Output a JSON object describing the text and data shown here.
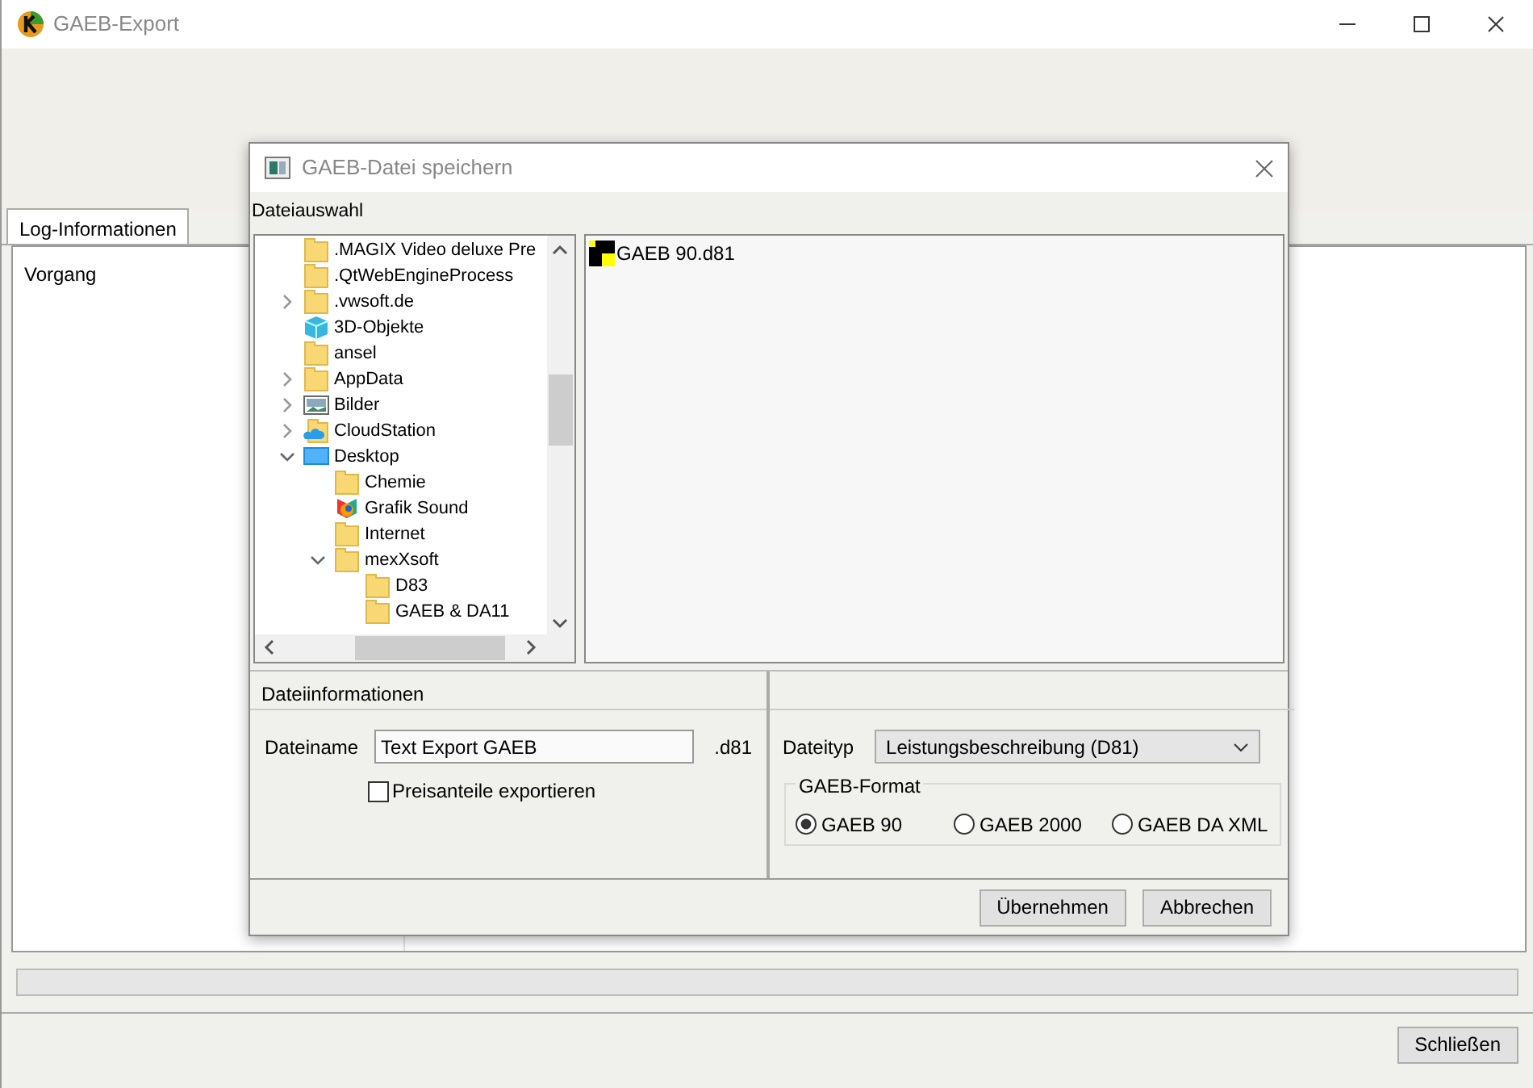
{
  "window": {
    "title": "GAEB-Export"
  },
  "tabs": [
    {
      "label": "Log-Informationen",
      "selected": true
    }
  ],
  "log": {
    "columns": [
      "Vorgang"
    ]
  },
  "progress": {
    "level": 0
  },
  "buttons": [
    "Schließen"
  ],
  "dialog": {
    "title": "GAEB-Datei speichern",
    "section_label": "Dateiauswahl",
    "tree": [
      {
        "label": ".MAGIX Video deluxe Pre",
        "kind": "folder"
      },
      {
        "label": ".QtWebEngineProcess",
        "kind": "folder"
      },
      {
        "label": ".vwsoft.de",
        "kind": "folder",
        "expanded": false
      },
      {
        "label": "3D-Objekte",
        "kind": "objects"
      },
      {
        "label": "ansel",
        "kind": "folder"
      },
      {
        "label": "AppData",
        "kind": "folder",
        "expanded": false
      },
      {
        "label": "Bilder",
        "kind": "pictures",
        "expanded": false
      },
      {
        "label": "CloudStation",
        "kind": "cloud",
        "expanded": false
      },
      {
        "label": "Desktop",
        "kind": "desktop",
        "expanded": true,
        "children": [
          {
            "label": "Chemie",
            "kind": "folder"
          },
          {
            "label": "Grafik Sound",
            "kind": "media"
          },
          {
            "label": "Internet",
            "kind": "folder"
          },
          {
            "label": "mexXsoft",
            "kind": "folder",
            "expanded": true,
            "children": [
              {
                "label": "D83",
                "kind": "folder"
              },
              {
                "label": "GAEB & DA11",
                "kind": "folder"
              }
            ]
          }
        ]
      }
    ],
    "files": [
      {
        "name": "GAEB 90.d81"
      }
    ],
    "file_info": {
      "heading": "Dateiinformationen",
      "filename_label": "Dateiname",
      "filename": "Text Export GAEB",
      "extension": ".d81",
      "checkbox": {
        "label": "Preisanteile exportieren",
        "checked": false
      }
    },
    "type_panel": {
      "filetype_label": "Dateityp",
      "filetype": "Leistungsbeschreibung (D81)",
      "format_legend": "GAEB-Format",
      "formats": [
        {
          "label": "GAEB 90",
          "selected": true
        },
        {
          "label": "GAEB 2000",
          "selected": false
        },
        {
          "label": "GAEB DA XML",
          "selected": false
        }
      ]
    },
    "buttons": [
      "Übernehmen",
      "Abbrechen"
    ]
  }
}
